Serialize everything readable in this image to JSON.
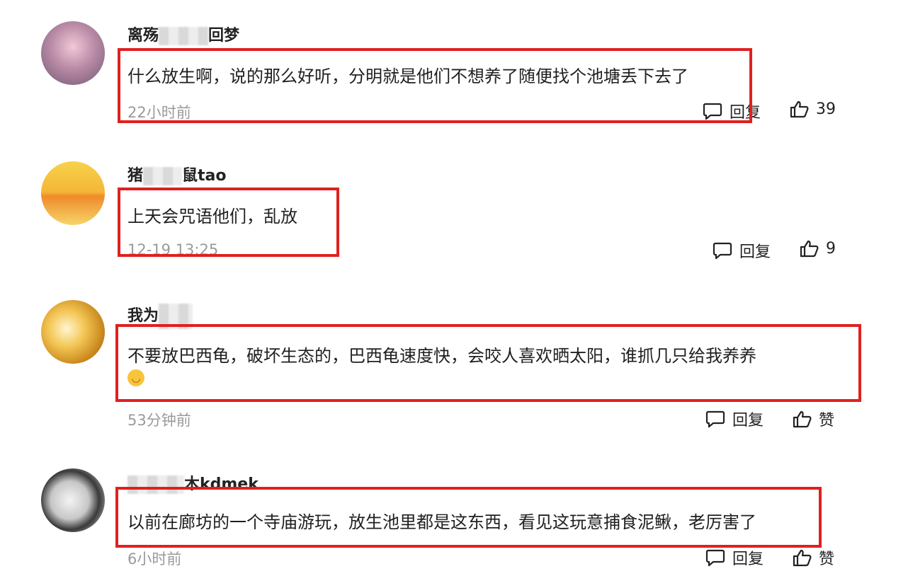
{
  "comments": [
    {
      "username_prefix": "离殇",
      "username_suffix": "回梦",
      "text": "什么放生啊，说的那么好听，分明就是他们不想养了随便找个池塘丢下去了",
      "time": "22小时前",
      "reply_label": "回复",
      "like_label": "39",
      "icons": [
        "comment-bubble-icon",
        "thumbs-up-icon"
      ]
    },
    {
      "username_prefix": "猪",
      "username_suffix": "鼠tao",
      "text": "上天会咒语他们，乱放",
      "time": "12-19 13:25",
      "reply_label": "回复",
      "like_label": "9",
      "icons": [
        "comment-bubble-icon",
        "thumbs-up-icon"
      ]
    },
    {
      "username_prefix": "我为",
      "username_suffix": "",
      "text": "不要放巴西龟，破坏生态的，巴西龟速度快，会咬人喜欢晒太阳，谁抓几只给我养养",
      "emoji": "smile-emoji",
      "time": "53分钟前",
      "reply_label": "回复",
      "like_label": "赞",
      "icons": [
        "comment-bubble-icon",
        "thumbs-up-icon"
      ]
    },
    {
      "username_prefix": "",
      "username_suffix": "木kdmek",
      "text": "以前在廊坊的一个寺庙游玩，放生池里都是这东西，看见这玩意捕食泥鳅，老厉害了",
      "time": "6小时前",
      "reply_label": "回复",
      "like_label": "赞",
      "icons": [
        "comment-bubble-icon",
        "thumbs-up-icon"
      ]
    }
  ],
  "colors": {
    "highlight_box": "#e02020",
    "time_text": "#9a9a9a"
  }
}
